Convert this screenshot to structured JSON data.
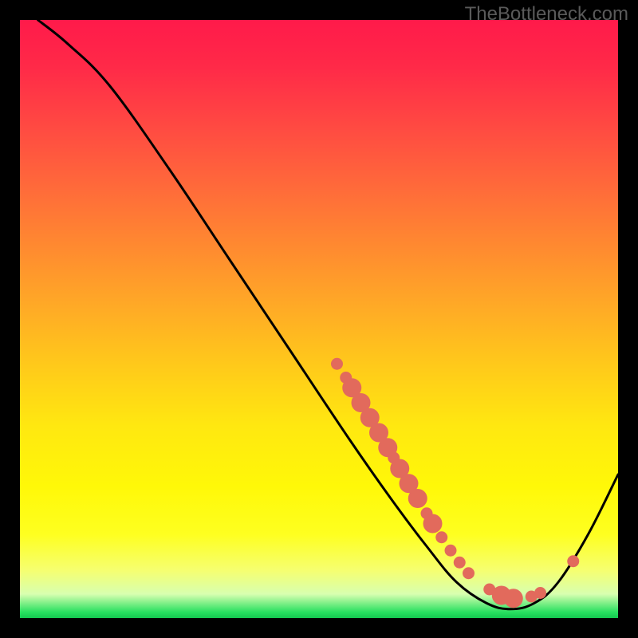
{
  "watermark": "TheBottleneck.com",
  "chart_data": {
    "type": "line",
    "title": "",
    "xlabel": "",
    "ylabel": "",
    "xlim": [
      0,
      100
    ],
    "ylim": [
      0,
      100
    ],
    "curve": [
      {
        "x": 3,
        "y": 100
      },
      {
        "x": 8,
        "y": 96
      },
      {
        "x": 15,
        "y": 89
      },
      {
        "x": 25,
        "y": 75
      },
      {
        "x": 35,
        "y": 60
      },
      {
        "x": 45,
        "y": 45
      },
      {
        "x": 55,
        "y": 30
      },
      {
        "x": 62,
        "y": 20
      },
      {
        "x": 68,
        "y": 12
      },
      {
        "x": 73,
        "y": 6
      },
      {
        "x": 78,
        "y": 2.5
      },
      {
        "x": 82,
        "y": 1.5
      },
      {
        "x": 86,
        "y": 2.5
      },
      {
        "x": 90,
        "y": 6
      },
      {
        "x": 95,
        "y": 14
      },
      {
        "x": 100,
        "y": 24
      }
    ],
    "markers": [
      {
        "x": 53,
        "y": 42.5,
        "r": 1.0
      },
      {
        "x": 54.5,
        "y": 40.2,
        "r": 1.0
      },
      {
        "x": 55.5,
        "y": 38.5,
        "r": 1.6
      },
      {
        "x": 57,
        "y": 36.0,
        "r": 1.6
      },
      {
        "x": 58.5,
        "y": 33.5,
        "r": 1.6
      },
      {
        "x": 60,
        "y": 31.0,
        "r": 1.6
      },
      {
        "x": 61.5,
        "y": 28.5,
        "r": 1.6
      },
      {
        "x": 62.5,
        "y": 26.8,
        "r": 1.0
      },
      {
        "x": 63.5,
        "y": 25.0,
        "r": 1.6
      },
      {
        "x": 65,
        "y": 22.5,
        "r": 1.6
      },
      {
        "x": 66.5,
        "y": 20.0,
        "r": 1.6
      },
      {
        "x": 68,
        "y": 17.5,
        "r": 1.0
      },
      {
        "x": 69,
        "y": 15.8,
        "r": 1.6
      },
      {
        "x": 70.5,
        "y": 13.5,
        "r": 1.0
      },
      {
        "x": 72,
        "y": 11.3,
        "r": 1.0
      },
      {
        "x": 73.5,
        "y": 9.3,
        "r": 1.0
      },
      {
        "x": 75,
        "y": 7.5,
        "r": 1.0
      },
      {
        "x": 78.5,
        "y": 4.8,
        "r": 1.0
      },
      {
        "x": 80.5,
        "y": 3.8,
        "r": 1.6
      },
      {
        "x": 82.5,
        "y": 3.3,
        "r": 1.6
      },
      {
        "x": 85.5,
        "y": 3.6,
        "r": 1.0
      },
      {
        "x": 87,
        "y": 4.2,
        "r": 1.0
      },
      {
        "x": 92.5,
        "y": 9.5,
        "r": 1.0
      }
    ]
  }
}
